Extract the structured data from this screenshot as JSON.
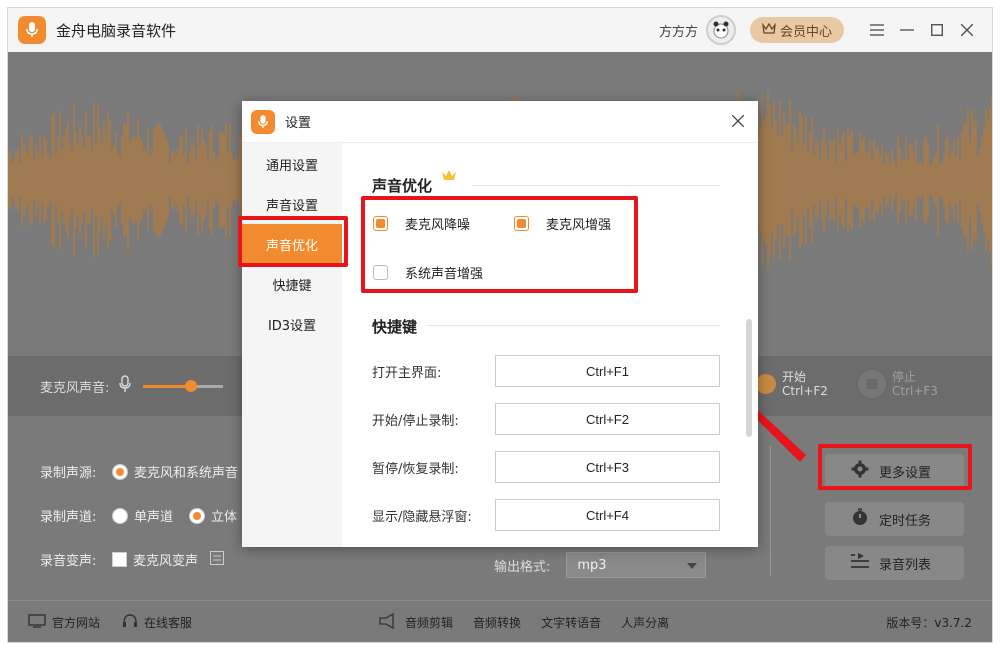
{
  "app": {
    "title": "金舟电脑录音软件",
    "username": "方方方",
    "vip_label": "会员中心",
    "brand_color": "#f28b30"
  },
  "control": {
    "mic_volume_label": "麦克风声音:",
    "mic_volume_level": 0.6,
    "start_label": "开始",
    "start_hotkey": "Ctrl+F2",
    "stop_label": "停止",
    "stop_hotkey": "Ctrl+F3"
  },
  "options": {
    "source_label": "录制声源:",
    "source_value": "麦克风和系统声音",
    "channel_label": "录制声道:",
    "channel_mono": "单声道",
    "channel_stereo": "立体",
    "voice_change_label": "录音变声:",
    "voice_change_option": "麦克风变声",
    "output_format_label": "输出格式:",
    "output_format_value": "mp3"
  },
  "side_buttons": {
    "more_settings": "更多设置",
    "timer_task": "定时任务",
    "record_list": "录音列表"
  },
  "footer": {
    "website": "官方网站",
    "support": "在线客服",
    "audio_cut": "音频剪辑",
    "audio_convert": "音频转换",
    "text_to_speech": "文字转语音",
    "vocal_separation": "人声分离",
    "version": "版本号：v3.7.2"
  },
  "dialog": {
    "title": "设置",
    "nav": [
      "通用设置",
      "声音设置",
      "声音优化",
      "快捷键",
      "ID3设置"
    ],
    "active_nav": "声音优化",
    "sound_opt": {
      "title": "声音优化",
      "mic_noise_reduction": "麦克风降噪",
      "mic_enhance": "麦克风增强",
      "system_enhance": "系统声音增强"
    },
    "hotkeys": {
      "title": "快捷键",
      "items": [
        {
          "label": "打开主界面:",
          "value": "Ctrl+F1"
        },
        {
          "label": "开始/停止录制:",
          "value": "Ctrl+F2"
        },
        {
          "label": "暂停/恢复录制:",
          "value": "Ctrl+F3"
        },
        {
          "label": "显示/隐藏悬浮窗:",
          "value": "Ctrl+F4"
        }
      ]
    }
  }
}
